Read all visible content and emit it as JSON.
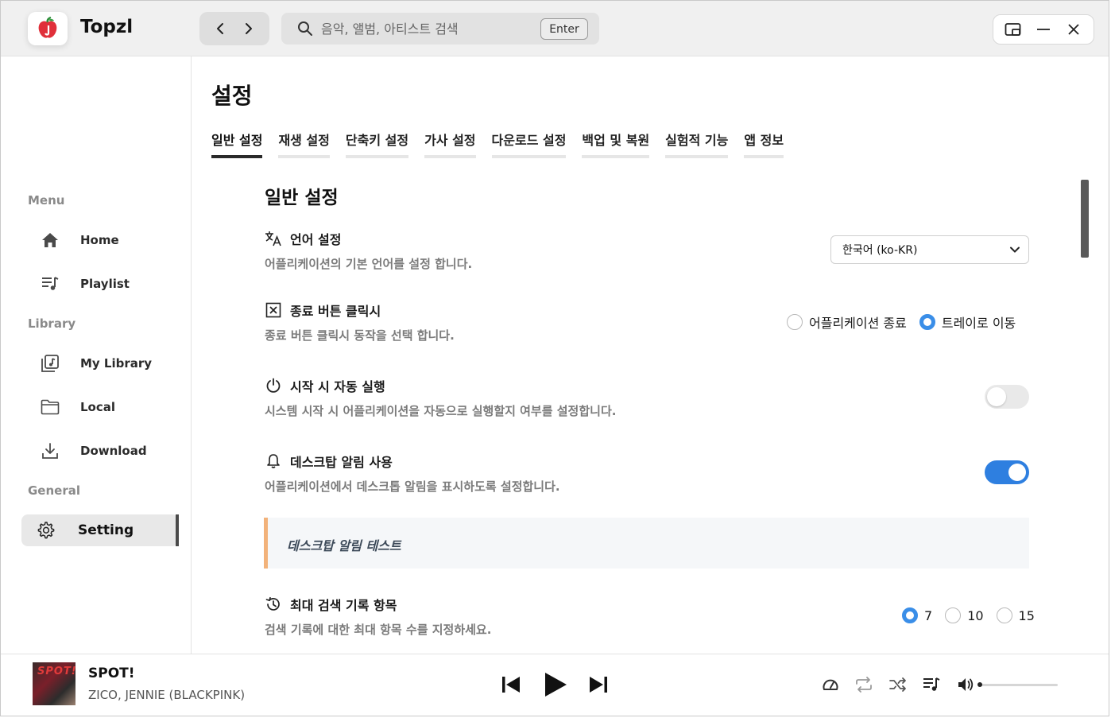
{
  "app": {
    "title": "Topzl"
  },
  "search": {
    "placeholder": "음악, 앨범, 아티스트 검색",
    "enter_key": "Enter"
  },
  "sidebar": {
    "sections": {
      "menu": "Menu",
      "library": "Library",
      "general": "General"
    },
    "items": [
      {
        "label": "Home",
        "icon": "home-icon"
      },
      {
        "label": "Playlist",
        "icon": "playlist-icon"
      },
      {
        "label": "My Library",
        "icon": "library-icon"
      },
      {
        "label": "Local",
        "icon": "folder-icon"
      },
      {
        "label": "Download",
        "icon": "download-icon"
      },
      {
        "label": "Setting",
        "icon": "gear-icon",
        "active": true
      }
    ]
  },
  "page": {
    "title": "설정",
    "tabs": [
      {
        "label": "일반 설정",
        "active": true
      },
      {
        "label": "재생 설정"
      },
      {
        "label": "단축키 설정"
      },
      {
        "label": "가사 설정"
      },
      {
        "label": "다운로드 설정"
      },
      {
        "label": "백업 및 복원"
      },
      {
        "label": "실험적 기능"
      },
      {
        "label": "앱 정보"
      }
    ],
    "section_title": "일반 설정",
    "settings": {
      "language": {
        "title": "언어 설정",
        "desc": "어플리케이션의 기본 언어를 설정 합니다.",
        "value": "한국어 (ko-KR)"
      },
      "close_button": {
        "title": "종료 버튼 클릭시",
        "desc": "종료 버튼 클릭시 동작을 선택 합니다.",
        "options": [
          "어플리케이션 종료",
          "트레이로 이동"
        ],
        "selected": "트레이로 이동"
      },
      "autostart": {
        "title": "시작 시 자동 실행",
        "desc": "시스템 시작 시 어플리케이션을 자동으로 실행할지 여부를 설정합니다.",
        "enabled": false
      },
      "desktop_notify": {
        "title": "데스크탑 알림 사용",
        "desc": "어플리케이션에서 데스크톱 알림을 표시하도록 설정합니다.",
        "enabled": true,
        "test_label": "데스크탑 알림 테스트"
      },
      "search_history": {
        "title": "최대 검색 기록 항목",
        "desc": "검색 기록에 대한 최대 항목 수를 지정하세요.",
        "options": [
          "7",
          "10",
          "15"
        ],
        "selected": "7"
      }
    }
  },
  "player": {
    "cover_text": "SPOT!",
    "title": "SPOT!",
    "artist": "ZICO, JENNIE (BLACKPINK)",
    "volume": 0.0
  },
  "colors": {
    "accent": "#2e7fe0",
    "radio_on": "#3a8ee8",
    "callout_border": "#f2b27a",
    "logo_red": "#e0303a"
  }
}
